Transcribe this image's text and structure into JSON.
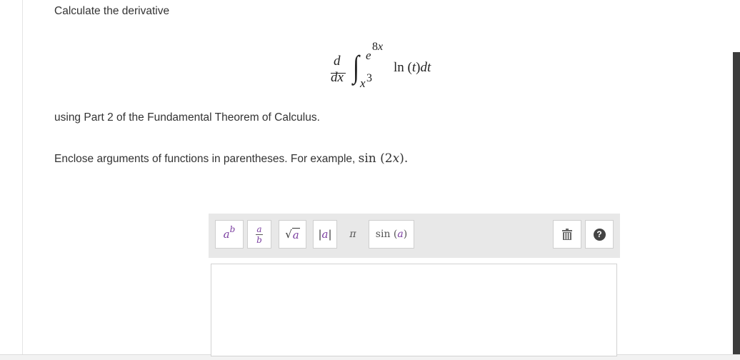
{
  "question": {
    "instruction": "Calculate the derivative",
    "method": "using Part 2 of the Fundamental Theorem of Calculus.",
    "hint_prefix": "Enclose arguments of functions in parentheses. For example,",
    "hint_example": "sin (2x).",
    "formula": {
      "d_num": "d",
      "d_den": "dx",
      "integral": "∫",
      "upper_base": "e",
      "upper_exp": "8x",
      "lower_base": "x",
      "lower_exp": "3",
      "integrand": "ln (t)dt"
    }
  },
  "toolbar": {
    "power": {
      "base": "a",
      "exp": "b"
    },
    "fraction": {
      "num": "a",
      "den": "b"
    },
    "sqrt": {
      "radical": "√",
      "arg": "a"
    },
    "abs": {
      "bar_l": "|",
      "arg": "a",
      "bar_r": "|"
    },
    "pi": "π",
    "sin": {
      "fn": "sin (",
      "arg": "a",
      "close": ")"
    },
    "trash_icon": "trash-icon",
    "help": "?"
  }
}
